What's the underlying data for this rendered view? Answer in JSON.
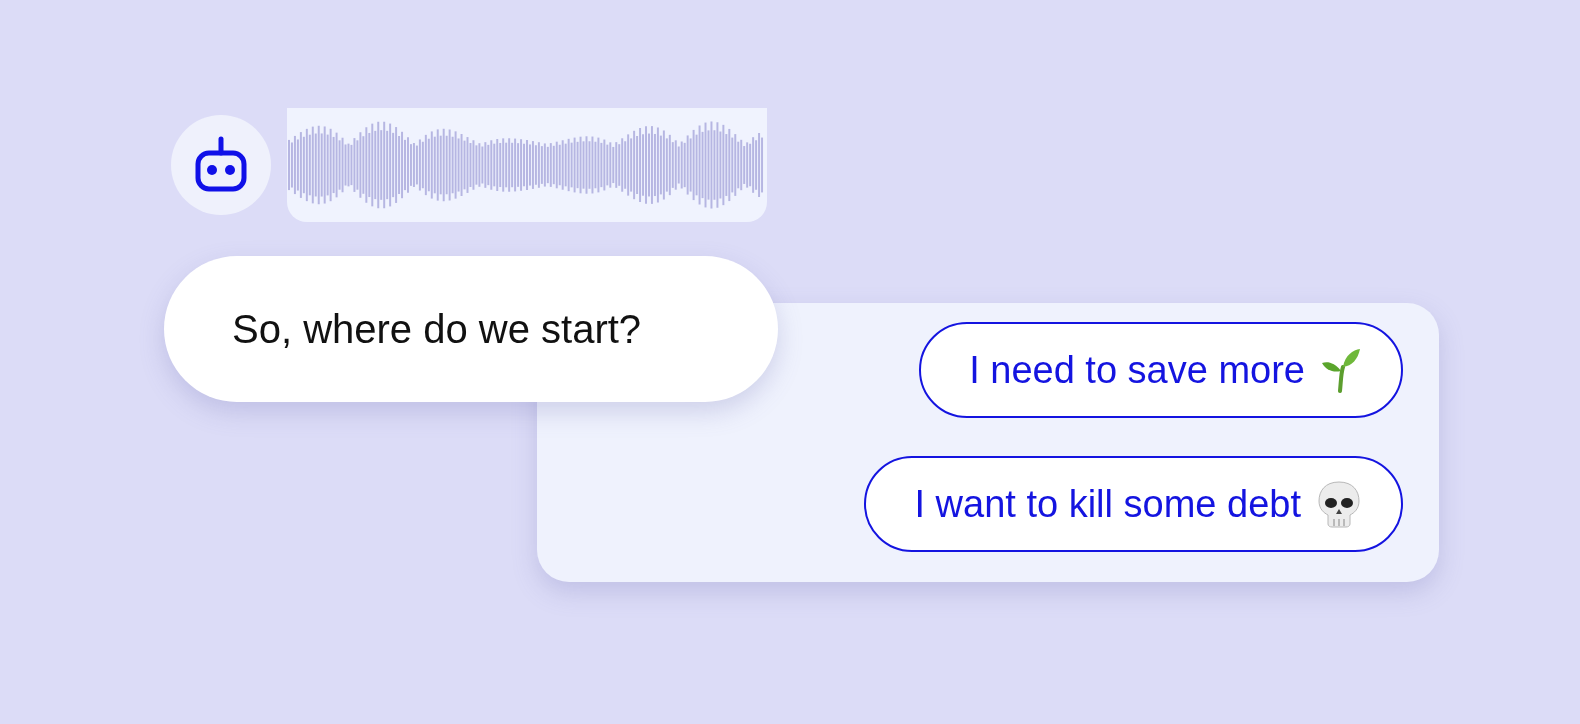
{
  "bot_message": {
    "kind": "voice"
  },
  "bot_bubble": {
    "text": "So, where do we start?"
  },
  "quick_replies": [
    {
      "label": "I need to save more",
      "kind": "sprout"
    },
    {
      "label": "I want to kill some debt",
      "kind": "skull"
    }
  ]
}
